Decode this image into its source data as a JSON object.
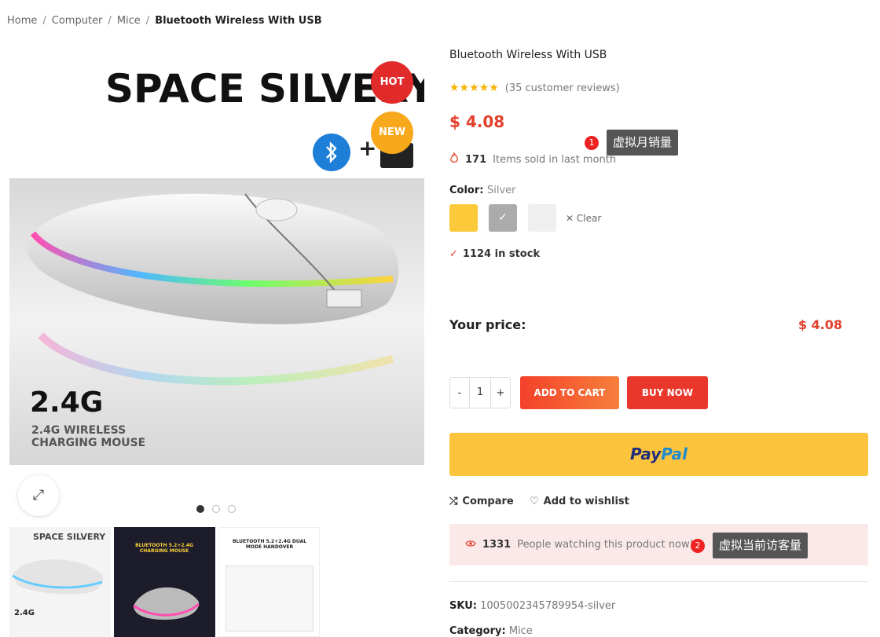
{
  "breadcrumb": {
    "home": "Home",
    "cat1": "Computer",
    "cat2": "Mice",
    "current": "Bluetooth Wireless With USB"
  },
  "image": {
    "title_text": "SPACE SILVERY",
    "plus": "+",
    "big_text": "2.4G",
    "sub_line1": "2.4G WIRELESS",
    "sub_line2": "CHARGING MOUSE",
    "badges": {
      "hot": "HOT",
      "new": "NEW"
    },
    "zoom_icon": "⤢"
  },
  "thumbnails": {
    "t1_title": "SPACE SILVERY",
    "t1_small": "2.4G",
    "t2_title": "BLUETOOTH 5.2+2.4G CHARGING MOUSE",
    "t3_title": "BLUETOOTH 5.2+2.4G DUAL MODE HANDOVER"
  },
  "product": {
    "title": "Bluetooth Wireless With USB",
    "stars": "★★★★★",
    "reviews": "(35 customer reviews)",
    "price": "$ 4.08",
    "sold_count": "171",
    "sold_text": "Items sold in last month",
    "color_label": "Color",
    "color_value": "Silver",
    "clear": "Clear",
    "stock": "1124 in stock",
    "your_price_label": "Your price:",
    "your_price_value": "$ 4.08",
    "qty_minus": "-",
    "qty_value": "1",
    "qty_plus": "+",
    "add_to_cart": "ADD TO CART",
    "buy_now": "BUY NOW",
    "paypal_1": "Pay",
    "paypal_2": "Pal",
    "compare": "Compare",
    "wishlist": "Add to wishlist",
    "watching_count": "1331",
    "watching_text": "People watching this product now!",
    "sku_label": "SKU:",
    "sku_value": "1005002345789954-silver",
    "category_label": "Category:",
    "category_value": "Mice"
  },
  "annotations": {
    "tip1_num": "1",
    "tip1_text": "虚拟月销量",
    "tip2_num": "2",
    "tip2_text": "虚拟当前访客量"
  },
  "colors": {
    "accent": "#e23f2b",
    "gold": "#fbc93a",
    "paypal": "#fcc33c"
  }
}
